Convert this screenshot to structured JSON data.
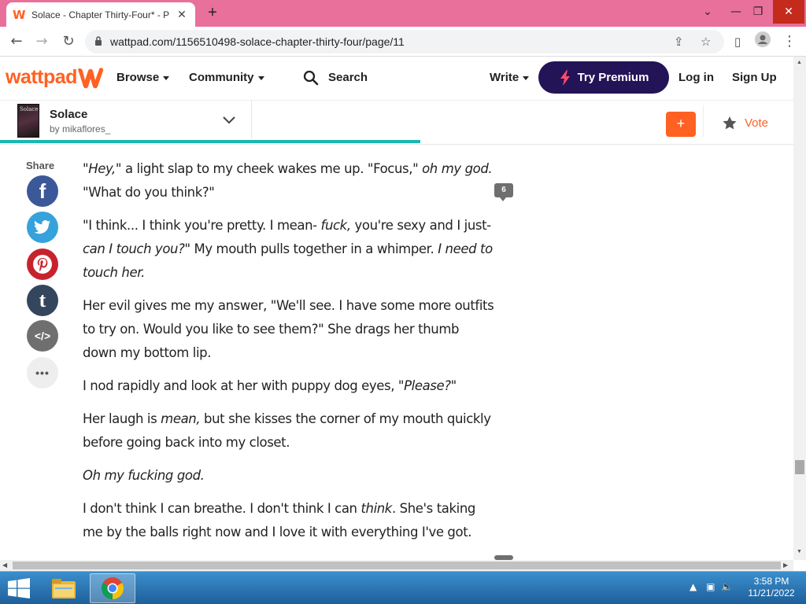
{
  "browser": {
    "tab_title": "Solace - Chapter Thirty-Four* - P",
    "url": "wattpad.com/1156510498-solace-chapter-thirty-four/page/11"
  },
  "header": {
    "logo": "wattpad",
    "browse": "Browse",
    "community": "Community",
    "search": "Search",
    "write": "Write",
    "premium": "Try Premium",
    "login": "Log in",
    "signup": "Sign Up"
  },
  "story": {
    "title": "Solace",
    "author": "by mikaflores_",
    "cover_text": "Solace",
    "add_label": "+",
    "vote_label": "Vote",
    "reading_progress": 0.53
  },
  "share": {
    "label": "Share",
    "facebook": "f",
    "tumblr": "t",
    "embed": "</>",
    "more": "•••"
  },
  "paragraphs": [
    [
      {
        "t": "\"",
        "i": true
      },
      {
        "t": "Hey,\"",
        "i": true
      },
      {
        "t": " a light slap to my cheek wakes me up. \"Focus,",
        "i": false
      },
      {
        "t": "\" oh my god.",
        "i": true
      },
      {
        "t": " \"What do you think?\"",
        "i": false
      }
    ],
    [
      {
        "t": "\"I think... I think you're pretty. I mean- ",
        "i": false
      },
      {
        "t": "fuck,",
        "i": true
      },
      {
        "t": " you're sexy and I just- ",
        "i": false
      },
      {
        "t": "can I touch you?\"",
        "i": true
      },
      {
        "t": " My mouth pulls together in a whimper. ",
        "i": false
      },
      {
        "t": "I need to touch her.",
        "i": true
      }
    ],
    [
      {
        "t": "Her evil gives me my answer, \"We'll see. I have some more outfits to try on. Would you like to see them?\" She drags her thumb down my bottom lip.",
        "i": false
      }
    ],
    [
      {
        "t": "I nod rapidly and look at her with puppy dog eyes, \"",
        "i": false
      },
      {
        "t": "Please?\"",
        "i": true
      }
    ],
    [
      {
        "t": "Her laugh is ",
        "i": false
      },
      {
        "t": "mean,",
        "i": true
      },
      {
        "t": " but she kisses the corner of my mouth quickly before going back into my closet.",
        "i": false
      }
    ],
    [
      {
        "t": "Oh my fucking god.",
        "i": true
      }
    ],
    [
      {
        "t": "I don't think I can breathe. I don't think I can ",
        "i": false
      },
      {
        "t": "think",
        "i": true
      },
      {
        "t": ". She's taking me by the balls right now and I love it with everything I've got.",
        "i": false
      }
    ]
  ],
  "comment_count": "6",
  "taskbar": {
    "time": "3:58 PM",
    "date": "11/21/2022"
  },
  "colors": {
    "brand": "#ff6122",
    "premium_bg": "#231357",
    "progress": "#18b7b5",
    "titlebar": "#e8709a"
  }
}
